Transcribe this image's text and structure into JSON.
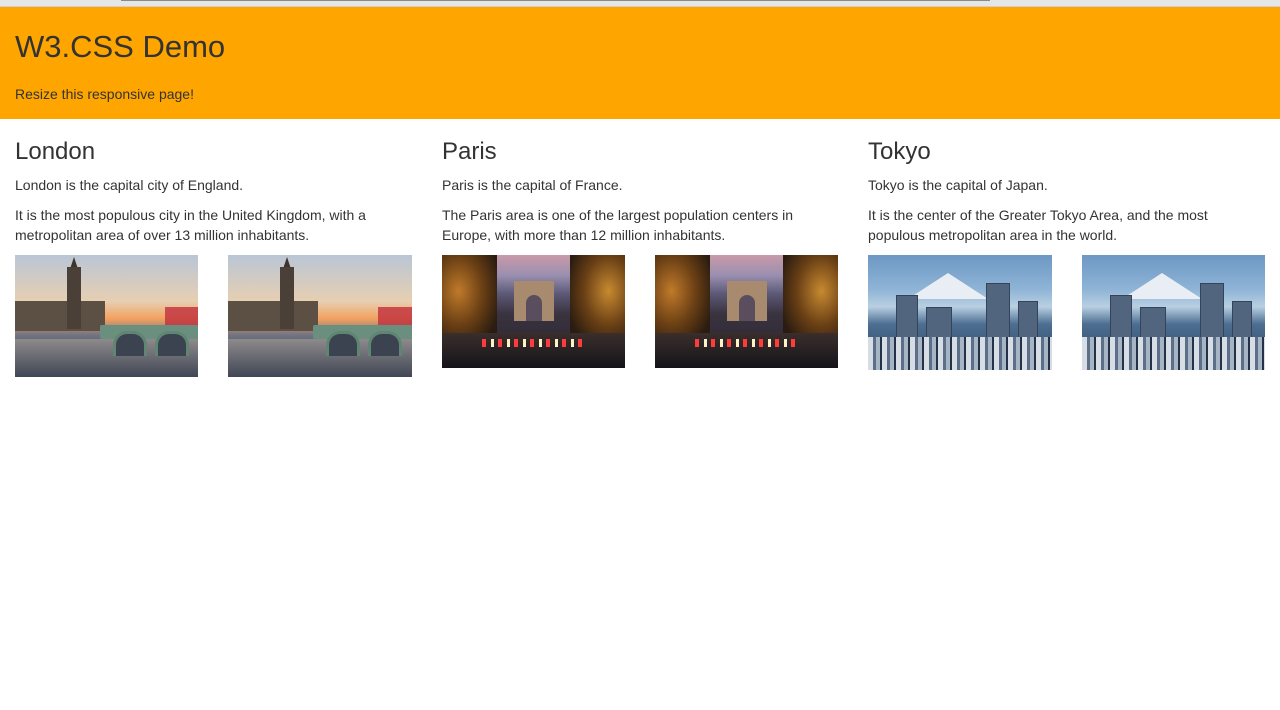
{
  "header": {
    "title": "W3.CSS Demo",
    "subtitle": "Resize this responsive page!",
    "background_color": "#ffa500"
  },
  "columns": [
    {
      "city": "London",
      "line1": "London is the capital city of England.",
      "line2": "It is the most populous city in the United Kingdom, with a metropolitan area of over 13 million inhabitants.",
      "image": "london-photo"
    },
    {
      "city": "Paris",
      "line1": "Paris is the capital of France.",
      "line2": "The Paris area is one of the largest population centers in Europe, with more than 12 million inhabitants.",
      "image": "paris-photo"
    },
    {
      "city": "Tokyo",
      "line1": "Tokyo is the capital of Japan.",
      "line2": "It is the center of the Greater Tokyo Area, and the most populous metropolitan area in the world.",
      "image": "tokyo-photo"
    }
  ]
}
